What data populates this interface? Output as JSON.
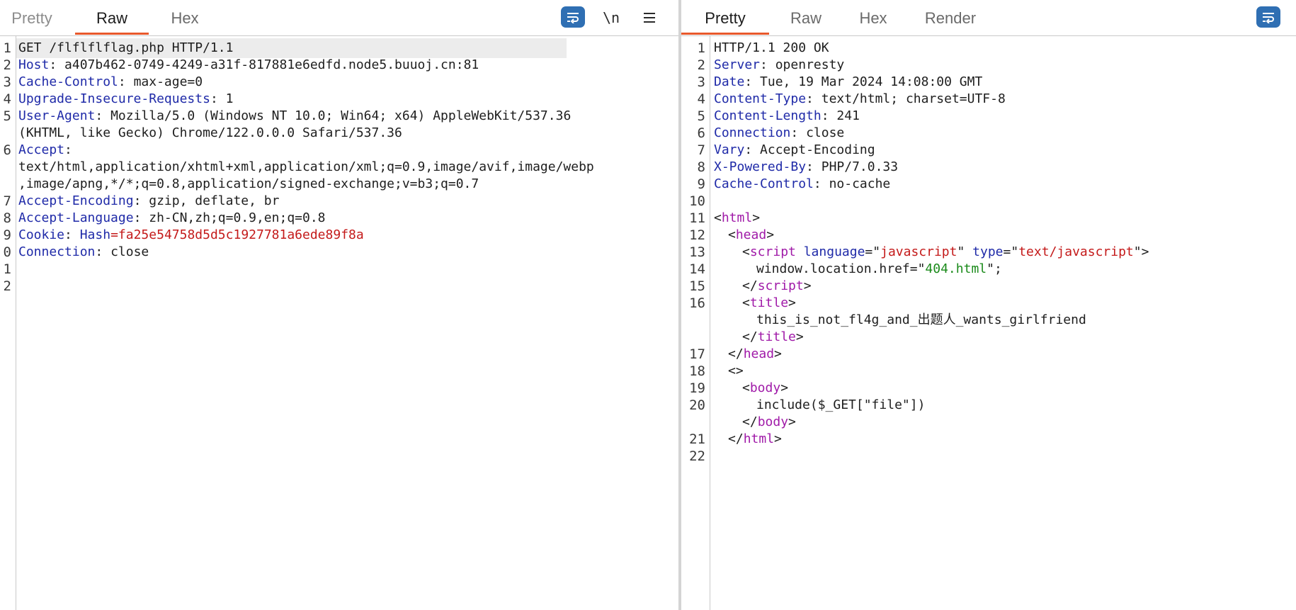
{
  "request": {
    "tabs": [
      {
        "label": "Pretty",
        "active": false
      },
      {
        "label": "Raw",
        "active": true
      },
      {
        "label": "Hex",
        "active": false
      }
    ],
    "tools": {
      "wrap_icon": "wrap-lines-icon",
      "newline_label": "\\n",
      "menu_icon": "hamburger-menu-icon"
    },
    "line_numbers": [
      "1",
      "2",
      "3",
      "4",
      "5",
      "",
      "6",
      "",
      "",
      "7",
      "8",
      "9",
      "0",
      "1",
      "2"
    ],
    "lines": [
      {
        "text": "GET /flflflflag.php HTTP/1.1"
      },
      {
        "key": "Host",
        "sep": ": ",
        "value": "a407b462-0749-4249-a31f-817881e6edfd.node5.buuoj.cn:81"
      },
      {
        "key": "Cache-Control",
        "sep": ": ",
        "value": "max-age=0"
      },
      {
        "key": "Upgrade-Insecure-Requests",
        "sep": ": ",
        "value": "1"
      },
      {
        "key": "User-Agent",
        "sep": ": ",
        "value": "Mozilla/5.0 (Windows NT 10.0; Win64; x64) AppleWebKit/537.36"
      },
      {
        "text": "(KHTML, like Gecko) Chrome/122.0.0.0 Safari/537.36"
      },
      {
        "key": "Accept",
        "sep": ":",
        "value": ""
      },
      {
        "text": "text/html,application/xhtml+xml,application/xml;q=0.9,image/avif,image/webp"
      },
      {
        "text": ",image/apng,*/*;q=0.8,application/signed-exchange;v=b3;q=0.7"
      },
      {
        "key": "Accept-Encoding",
        "sep": ": ",
        "value": "gzip, deflate, br"
      },
      {
        "key": "Accept-Language",
        "sep": ": ",
        "value": "zh-CN,zh;q=0.9,en;q=0.8"
      },
      {
        "key": "Cookie",
        "sep": ": ",
        "ckey": "Hash",
        "ceq": "=",
        "cval": "fa25e54758d5d5c1927781a6ede89f8a"
      },
      {
        "key": "Connection",
        "sep": ": ",
        "value": "close"
      },
      {
        "text": ""
      },
      {
        "text": ""
      }
    ]
  },
  "response": {
    "tabs": [
      {
        "label": "Pretty",
        "active": true
      },
      {
        "label": "Raw",
        "active": false
      },
      {
        "label": "Hex",
        "active": false
      },
      {
        "label": "Render",
        "active": false
      }
    ],
    "tools": {
      "wrap_icon": "wrap-lines-icon"
    },
    "line_numbers": [
      "1",
      "2",
      "3",
      "4",
      "5",
      "6",
      "7",
      "8",
      "9",
      "10",
      "11",
      "12",
      "13",
      "14",
      "15",
      "16",
      "",
      "",
      "17",
      "18",
      "19",
      "20",
      "",
      "21",
      "22"
    ],
    "lines": [
      {
        "text": "HTTP/1.1 200 OK"
      },
      {
        "key": "Server",
        "sep": ": ",
        "value": "openresty"
      },
      {
        "key": "Date",
        "sep": ": ",
        "value": "Tue, 19 Mar 2024 14:08:00 GMT"
      },
      {
        "key": "Content-Type",
        "sep": ": ",
        "value": "text/html; charset=UTF-8"
      },
      {
        "key": "Content-Length",
        "sep": ": ",
        "value": "241"
      },
      {
        "key": "Connection",
        "sep": ": ",
        "value": "close"
      },
      {
        "key": "Vary",
        "sep": ": ",
        "value": "Accept-Encoding"
      },
      {
        "key": "X-Powered-By",
        "sep": ": ",
        "value": "PHP/7.0.33"
      },
      {
        "key": "Cache-Control",
        "sep": ": ",
        "value": "no-cache"
      },
      {
        "text": ""
      },
      {
        "indent": 0,
        "parts": [
          {
            "t": "<",
            "c": "hv"
          },
          {
            "t": "html",
            "c": "tag"
          },
          {
            "t": ">",
            "c": "hv"
          }
        ]
      },
      {
        "indent": 1,
        "parts": [
          {
            "t": "<",
            "c": "hv"
          },
          {
            "t": "head",
            "c": "tag"
          },
          {
            "t": ">",
            "c": "hv"
          }
        ]
      },
      {
        "indent": 2,
        "parts": [
          {
            "t": "<",
            "c": "hv"
          },
          {
            "t": "script",
            "c": "tag"
          },
          {
            "t": " ",
            "c": "hv"
          },
          {
            "t": "language",
            "c": "attr"
          },
          {
            "t": "=\"",
            "c": "hv"
          },
          {
            "t": "javascript",
            "c": "str"
          },
          {
            "t": "\" ",
            "c": "hv"
          },
          {
            "t": "type",
            "c": "attr"
          },
          {
            "t": "=\"",
            "c": "hv"
          },
          {
            "t": "text/javascript",
            "c": "str"
          },
          {
            "t": "\">",
            "c": "hv"
          }
        ]
      },
      {
        "indent": 3,
        "parts": [
          {
            "t": "window.location.href=\"",
            "c": "hv"
          },
          {
            "t": "404.html",
            "c": "gstr"
          },
          {
            "t": "\";",
            "c": "hv"
          }
        ]
      },
      {
        "indent": 2,
        "parts": [
          {
            "t": "</",
            "c": "hv"
          },
          {
            "t": "script",
            "c": "tag"
          },
          {
            "t": ">",
            "c": "hv"
          }
        ]
      },
      {
        "indent": 2,
        "parts": [
          {
            "t": "<",
            "c": "hv"
          },
          {
            "t": "title",
            "c": "tag"
          },
          {
            "t": ">",
            "c": "hv"
          }
        ]
      },
      {
        "indent": 3,
        "parts": [
          {
            "t": "this_is_not_fl4g_and_出题人_wants_girlfriend",
            "c": "hv"
          }
        ]
      },
      {
        "indent": 2,
        "parts": [
          {
            "t": "</",
            "c": "hv"
          },
          {
            "t": "title",
            "c": "tag"
          },
          {
            "t": ">",
            "c": "hv"
          }
        ]
      },
      {
        "indent": 1,
        "parts": [
          {
            "t": "</",
            "c": "hv"
          },
          {
            "t": "head",
            "c": "tag"
          },
          {
            "t": ">",
            "c": "hv"
          }
        ]
      },
      {
        "indent": 1,
        "parts": [
          {
            "t": "<>",
            "c": "hv"
          }
        ]
      },
      {
        "indent": 2,
        "parts": [
          {
            "t": "<",
            "c": "hv"
          },
          {
            "t": "body",
            "c": "tag"
          },
          {
            "t": ">",
            "c": "hv"
          }
        ]
      },
      {
        "indent": 3,
        "parts": [
          {
            "t": "include($_GET[\"file\"])",
            "c": "hv"
          }
        ]
      },
      {
        "indent": 2,
        "parts": [
          {
            "t": "</",
            "c": "hv"
          },
          {
            "t": "body",
            "c": "tag"
          },
          {
            "t": ">",
            "c": "hv"
          }
        ]
      },
      {
        "indent": 1,
        "parts": [
          {
            "t": "</",
            "c": "hv"
          },
          {
            "t": "html",
            "c": "tag"
          },
          {
            "t": ">",
            "c": "hv"
          }
        ]
      },
      {
        "text": ""
      }
    ]
  }
}
